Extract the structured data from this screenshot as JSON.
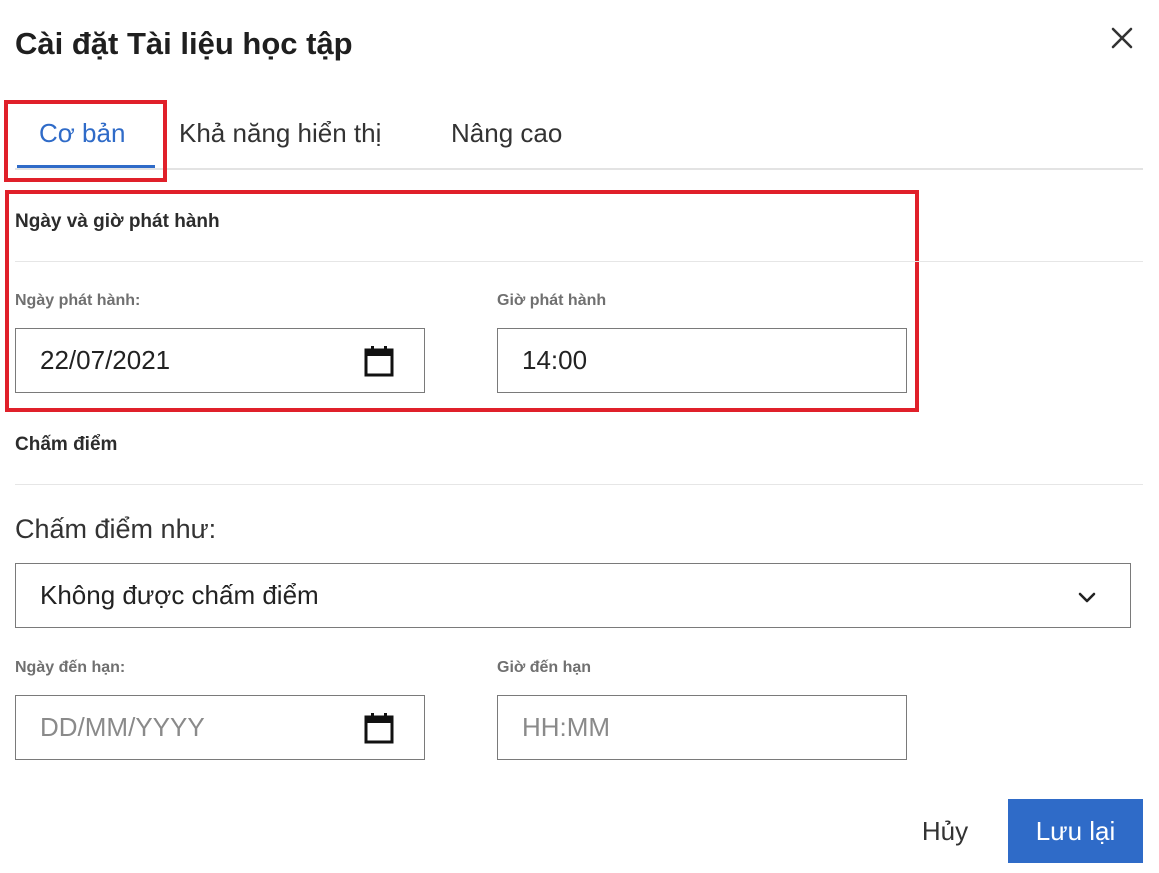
{
  "dialog": {
    "title": "Cài đặt Tài liệu học tập"
  },
  "tabs": [
    {
      "label": "Cơ bản",
      "active": true
    },
    {
      "label": "Khả năng hiển thị",
      "active": false
    },
    {
      "label": "Nâng cao",
      "active": false
    }
  ],
  "release": {
    "section_title": "Ngày và giờ phát hành",
    "date_label": "Ngày phát hành:",
    "date_value": "22/07/2021",
    "time_label": "Giờ phát hành",
    "time_value": "14:00"
  },
  "grading": {
    "section_title": "Chấm điểm",
    "grade_as_label": "Chấm điểm như:",
    "grade_as_value": "Không được chấm điểm",
    "due_date_label": "Ngày đến hạn:",
    "due_date_placeholder": "DD/MM/YYYY",
    "due_time_label": "Giờ đến hạn",
    "due_time_placeholder": "HH:MM"
  },
  "actions": {
    "cancel_label": "Hủy",
    "save_label": "Lưu lại"
  },
  "icons": {
    "close": "close-icon",
    "calendar": "calendar-icon",
    "dropdown": "chevron-down-icon"
  },
  "colors": {
    "accent": "#2f6bc8",
    "highlight": "#e0202a"
  }
}
